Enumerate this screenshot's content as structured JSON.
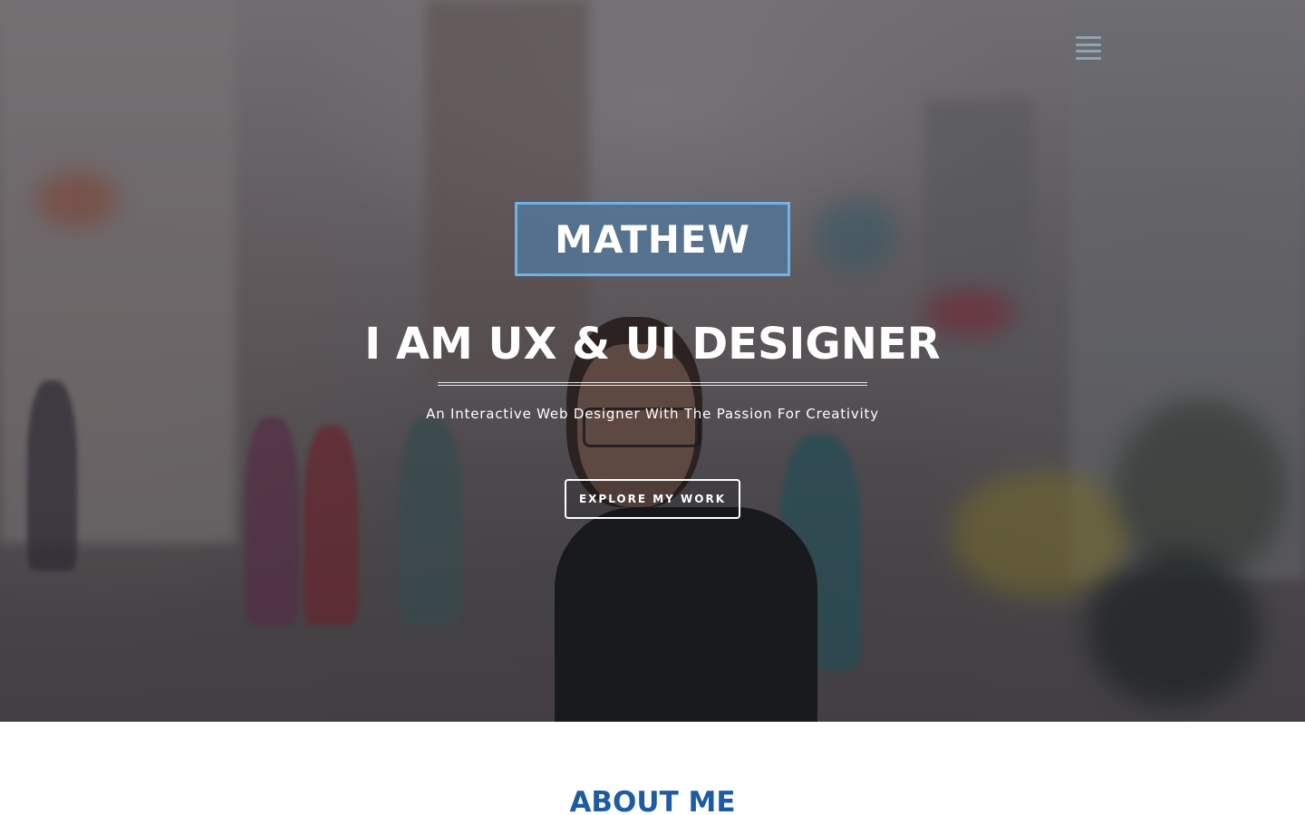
{
  "hero": {
    "name": "MATHEW",
    "headline": {
      "part1": "I AM ",
      "bold1": "UX",
      "part2": " & ",
      "bold2": "UI",
      "part3": " DESIGNER"
    },
    "tagline": "An Interactive Web Designer With The Passion For Creativity",
    "cta_label": "EXPLORE MY WORK"
  },
  "nav": {
    "menu_icon": "hamburger-menu-icon"
  },
  "about": {
    "title": "ABOUT ME"
  },
  "colors": {
    "accent_border": "#6fb2e6",
    "name_box_bg": "#527696",
    "about_title": "#1e5ba6",
    "menu_icon": "#8fa2b6"
  }
}
